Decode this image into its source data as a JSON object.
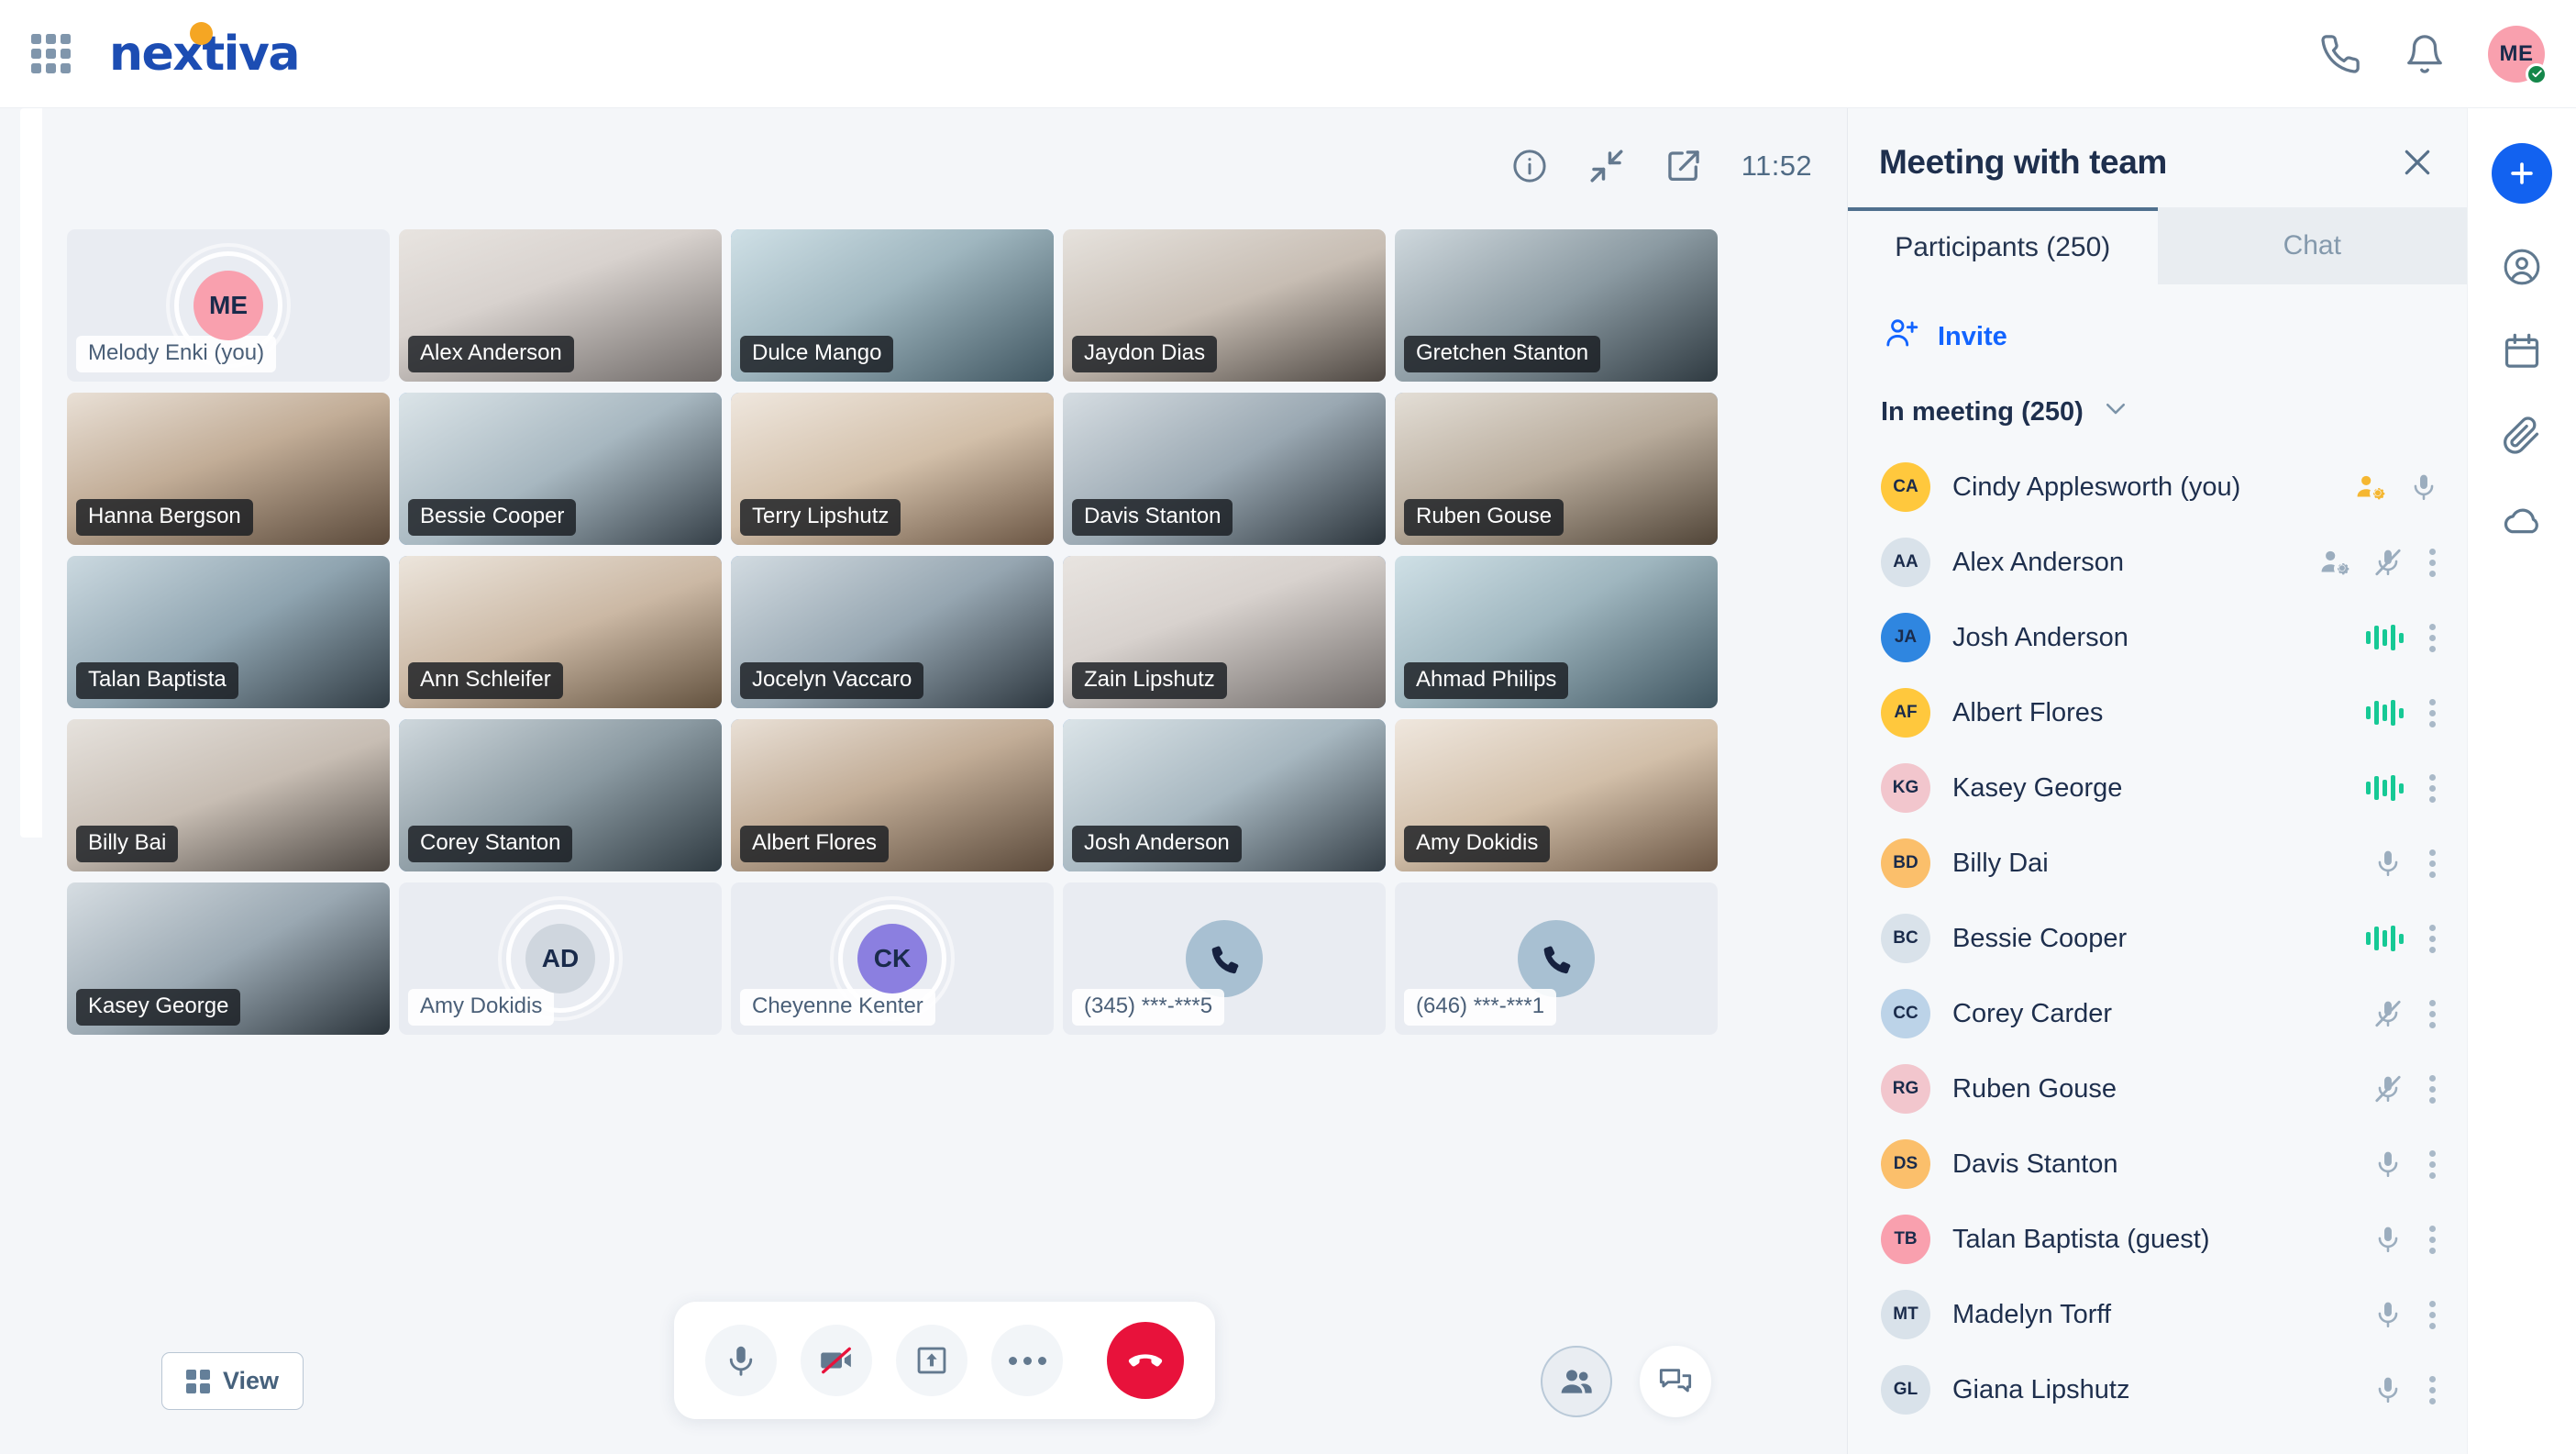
{
  "topbar": {
    "brand": "nextiva",
    "grid_menu_icon": "apps-grid-icon",
    "phone_icon": "phone-icon",
    "bell_icon": "bell-icon",
    "avatar_initials": "ME",
    "avatar_status": "online"
  },
  "stage": {
    "info_icon": "info-circle-icon",
    "collapse_icon": "collapse-arrows-icon",
    "popout_icon": "pop-out-icon",
    "clock": "11:52",
    "view_button": "View",
    "tiles": [
      {
        "name": "Melody Enki (you)",
        "state": "camera-off",
        "initials": "ME",
        "avatar_color": "av-p",
        "speaking": false
      },
      {
        "name": "Alex Anderson",
        "state": "video",
        "bg": "p1",
        "speaking": false
      },
      {
        "name": "Dulce Mango",
        "state": "video",
        "bg": "p2",
        "speaking": true
      },
      {
        "name": "Jaydon Dias",
        "state": "video",
        "bg": "p3",
        "speaking": false
      },
      {
        "name": "Gretchen Stanton",
        "state": "video",
        "bg": "p4",
        "speaking": false
      },
      {
        "name": "Hanna Bergson",
        "state": "video",
        "bg": "p5",
        "speaking": false
      },
      {
        "name": "Bessie Cooper",
        "state": "video",
        "bg": "p6",
        "speaking": true
      },
      {
        "name": "Terry Lipshutz",
        "state": "video",
        "bg": "p7",
        "speaking": true
      },
      {
        "name": "Davis Stanton",
        "state": "video",
        "bg": "p8",
        "speaking": false
      },
      {
        "name": "Ruben Gouse",
        "state": "video",
        "bg": "p9",
        "speaking": true
      },
      {
        "name": "Talan Baptista",
        "state": "video",
        "bg": "p10",
        "speaking": false
      },
      {
        "name": "Ann Schleifer",
        "state": "video",
        "bg": "p11",
        "speaking": true
      },
      {
        "name": "Jocelyn Vaccaro",
        "state": "video",
        "bg": "p12",
        "speaking": true
      },
      {
        "name": "Zain Lipshutz",
        "state": "video",
        "bg": "p1",
        "speaking": true
      },
      {
        "name": "Ahmad Philips",
        "state": "video",
        "bg": "p2",
        "speaking": false
      },
      {
        "name": "Billy Bai",
        "state": "video",
        "bg": "p3",
        "speaking": false
      },
      {
        "name": "Corey Stanton",
        "state": "video",
        "bg": "p4",
        "speaking": true
      },
      {
        "name": "Albert Flores",
        "state": "video",
        "bg": "p5",
        "speaking": true
      },
      {
        "name": "Josh Anderson",
        "state": "video",
        "bg": "p6",
        "speaking": true
      },
      {
        "name": "Amy Dokidis",
        "state": "video",
        "bg": "p7",
        "speaking": false
      },
      {
        "name": "Kasey George",
        "state": "video",
        "bg": "p8",
        "speaking": false
      },
      {
        "name": "Amy Dokidis",
        "state": "camera-off",
        "initials": "AD",
        "avatar_color": "av-g",
        "speaking": false
      },
      {
        "name": "Cheyenne Kenter",
        "state": "camera-off",
        "initials": "CK",
        "avatar_color": "av-v",
        "speaking": false
      },
      {
        "name": "(345) ***-***5",
        "state": "phone",
        "speaking": false
      },
      {
        "name": "(646) ***-***1",
        "state": "phone",
        "speaking": false
      }
    ],
    "controls": {
      "mic_icon": "microphone-icon",
      "camera_off_icon": "camera-off-icon",
      "share_screen_icon": "share-screen-icon",
      "more_icon": "more-options-icon",
      "end_call_icon": "end-call-icon",
      "participants_icon": "participants-icon",
      "chat_icon": "chat-icon"
    }
  },
  "panel": {
    "title": "Meeting with team",
    "close_icon": "close-icon",
    "tabs": [
      {
        "label": "Participants (250)",
        "active": true
      },
      {
        "label": "Chat",
        "active": false
      }
    ],
    "invite_label": "Invite",
    "invite_icon": "add-person-icon",
    "section_label": "In meeting (250)",
    "chevron_icon": "chevron-down-icon",
    "participants": [
      {
        "name": "Cindy Applesworth (you)",
        "avatar_color": "av-y",
        "initials": "CA",
        "host": "yellow",
        "audio": "mic",
        "kebab": false
      },
      {
        "name": "Alex Anderson",
        "avatar_color": "av-t",
        "initials": "AA",
        "host": "gray",
        "audio": "mic-muted",
        "kebab": true
      },
      {
        "name": "Josh Anderson",
        "avatar_color": "av-b",
        "initials": "JA",
        "host": "none",
        "audio": "wave",
        "kebab": true
      },
      {
        "name": "Albert Flores",
        "avatar_color": "av-y",
        "initials": "AF",
        "host": "none",
        "audio": "wave",
        "kebab": true
      },
      {
        "name": "Kasey George",
        "avatar_color": "av-r",
        "initials": "KG",
        "host": "none",
        "audio": "wave",
        "kebab": true
      },
      {
        "name": "Billy Dai",
        "avatar_color": "av-o",
        "initials": "BD",
        "host": "none",
        "audio": "mic",
        "kebab": true
      },
      {
        "name": "Bessie Cooper",
        "avatar_color": "av-t",
        "initials": "BC",
        "host": "none",
        "audio": "wave",
        "kebab": true
      },
      {
        "name": "Corey Carder",
        "avatar_color": "av-c",
        "initials": "CC",
        "host": "none",
        "audio": "mic-muted",
        "kebab": true
      },
      {
        "name": "Ruben Gouse",
        "avatar_color": "av-r",
        "initials": "RG",
        "host": "none",
        "audio": "mic-muted",
        "kebab": true
      },
      {
        "name": "Davis Stanton",
        "avatar_color": "av-o",
        "initials": "DS",
        "host": "none",
        "audio": "mic",
        "kebab": true
      },
      {
        "name": "Talan Baptista (guest)",
        "avatar_color": "av-p",
        "initials": "TB",
        "host": "none",
        "audio": "mic",
        "kebab": true
      },
      {
        "name": "Madelyn Torff",
        "avatar_color": "av-t",
        "initials": "MT",
        "host": "none",
        "audio": "mic",
        "kebab": true
      },
      {
        "name": "Giana Lipshutz",
        "avatar_color": "av-t",
        "initials": "GL",
        "host": "none",
        "audio": "mic",
        "kebab": true
      }
    ]
  },
  "rail": {
    "add_icon": "plus-icon",
    "items": [
      {
        "icon": "contacts-icon"
      },
      {
        "icon": "calendar-icon"
      },
      {
        "icon": "attachment-icon"
      },
      {
        "icon": "cloud-icon"
      }
    ]
  },
  "colors": {
    "brand_blue": "#1c4db3",
    "brand_orange": "#f5a623",
    "accent_blue": "#1262f0",
    "end_red": "#e8123b",
    "speaking_green": "#16c995",
    "status_green": "#15874a"
  }
}
